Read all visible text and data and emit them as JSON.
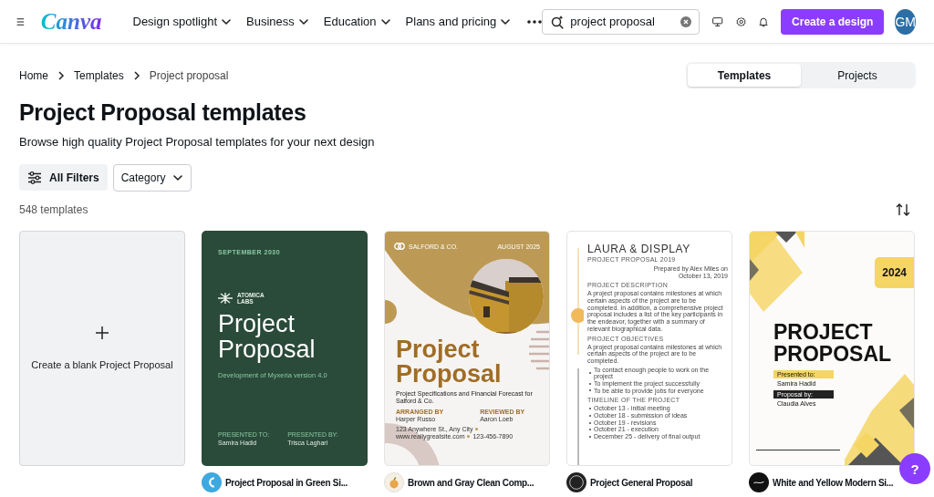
{
  "logo": "Canva",
  "nav": [
    {
      "label": "Design spotlight"
    },
    {
      "label": "Business"
    },
    {
      "label": "Education"
    },
    {
      "label": "Plans and pricing"
    }
  ],
  "search": {
    "value": "project proposal"
  },
  "create_button": "Create a design",
  "avatar": "GM",
  "breadcrumbs": [
    "Home",
    "Templates",
    "Project proposal"
  ],
  "view_tabs": [
    {
      "label": "Templates",
      "selected": true
    },
    {
      "label": "Projects",
      "selected": false
    }
  ],
  "title": "Project Proposal templates",
  "subtitle": "Browse high quality Project Proposal templates for your next design",
  "filters": {
    "all_filters": "All Filters",
    "category": "Category"
  },
  "count": "548 templates",
  "blank_card": {
    "label": "Create a blank Project Proposal"
  },
  "templates": [
    {
      "title": "Project Proposal in Green Si...",
      "design": {
        "kind": "green",
        "date": "SEPTEMBER 2030",
        "brand": "ATOMICA LABS",
        "heading": "Project Proposal",
        "subheading": "Development of Myxeria version 4.0",
        "people": [
          {
            "role": "PRESENTED TO:",
            "name": "Samira Hadid"
          },
          {
            "role": "PRESENTED BY:",
            "name": "Trisca Laghari"
          }
        ]
      }
    },
    {
      "title": "Brown and Gray Clean Comp...",
      "design": {
        "kind": "brown",
        "company": "SALFORD & CO.",
        "date": "AUGUST 2025",
        "heading": "Project Proposal",
        "subheading": "Project Specifications and Financial Forecast for Salford & Co.",
        "people": [
          {
            "role": "ARRANGED BY",
            "name": "Harper Russo"
          },
          {
            "role": "REVIEWED BY",
            "name": "Aaron Loeb"
          }
        ],
        "footer": [
          "123 Anywhere St., Any City",
          "www.reallygreatsite.com",
          "123-456-7890"
        ]
      }
    },
    {
      "title": "Project General Proposal",
      "design": {
        "kind": "document",
        "heading": "LAURA & DISPLAY",
        "subheading": "PROJECT PROPOSAL 2019",
        "prepared": "Prepared by Alex Miles on October 13, 2019",
        "sections": [
          {
            "heading": "PROJECT DESCRIPTION",
            "paragraph": "A project proposal contains milestones at which certain aspects of the project are to be completed. In addition, a comprehensive project proposal includes a list of the key participants in the endeavor, together with a summary of relevant biographical data."
          },
          {
            "heading": "PROJECT OBJECTIVES",
            "paragraph": "A project proposal contains milestones at which certain aspects of the project are to be completed.",
            "bullets": [
              "To contact enough people to work on the project",
              "To implement the project successfully",
              "To be able to provide jobs for everyone"
            ]
          },
          {
            "heading": "TIMELINE OF THE PROJECT",
            "bullets": [
              "October 13 - initial meeting",
              "October 18 - submission of ideas",
              "October 19 - revisions",
              "October 21 - execution",
              "December 25 - delivery of final output"
            ]
          }
        ]
      }
    },
    {
      "title": "White and Yellow Modern Si...",
      "design": {
        "kind": "yellow",
        "year": "2024",
        "heading": "PROJECT PROPOSAL",
        "fields": [
          {
            "kind": "light",
            "label": "Presented to:",
            "value": "Samira Hadid"
          },
          {
            "kind": "dark",
            "label": "Proposal by:",
            "value": "Claudia Alves"
          }
        ]
      }
    }
  ],
  "help_button": "?"
}
